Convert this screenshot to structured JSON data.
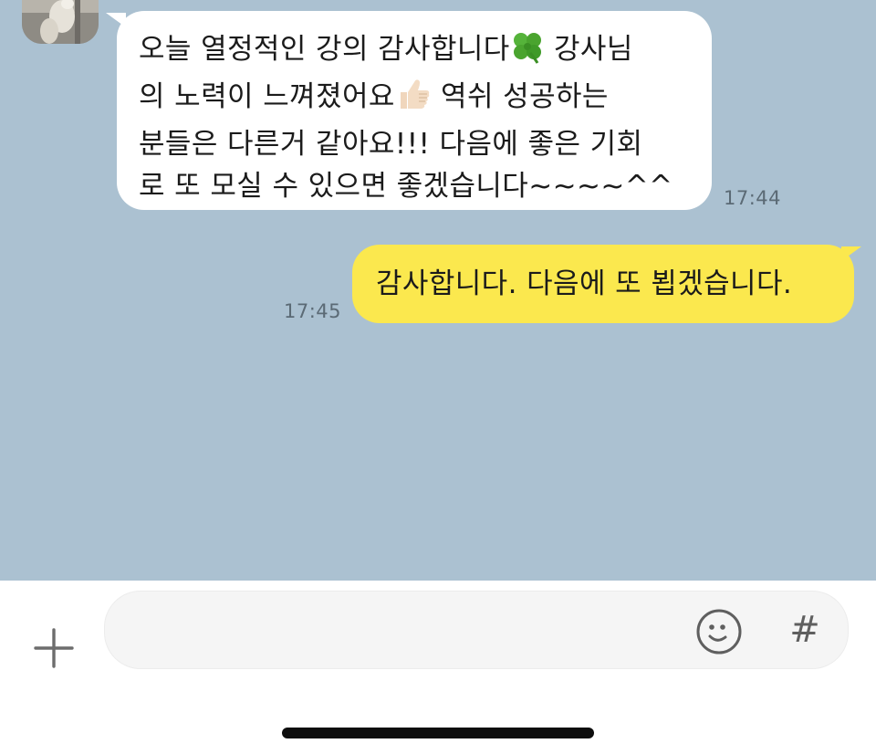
{
  "messages": [
    {
      "direction": "received",
      "lines": [
        "오늘 열정적인 강의 감사합니다",
        " 강사님",
        "의 노력이 느껴졌어요",
        " 역쉬 성공하는",
        "분들은 다른거 같아요!!! 다음에 좋은 기회",
        "로 또 모실 수 있으면 좋겠습니다~~~~^^"
      ],
      "emoji": [
        "four-leaf-clover-icon",
        "thumbs-up-icon"
      ],
      "time": "17:44"
    },
    {
      "direction": "sent",
      "text": "감사합니다. 다음에 또 뵙겠습니다.",
      "time": "17:45"
    }
  ],
  "input": {
    "value": "",
    "placeholder": ""
  },
  "input_bar": {
    "plus_icon": "plus-icon",
    "emoticon_icon": "smiley-icon",
    "hash_label": "#"
  },
  "colors": {
    "chat_background": "#abc1d1",
    "sent_bubble": "#fbe84e",
    "received_bubble": "#ffffff",
    "time_text": "#5b6a75"
  }
}
